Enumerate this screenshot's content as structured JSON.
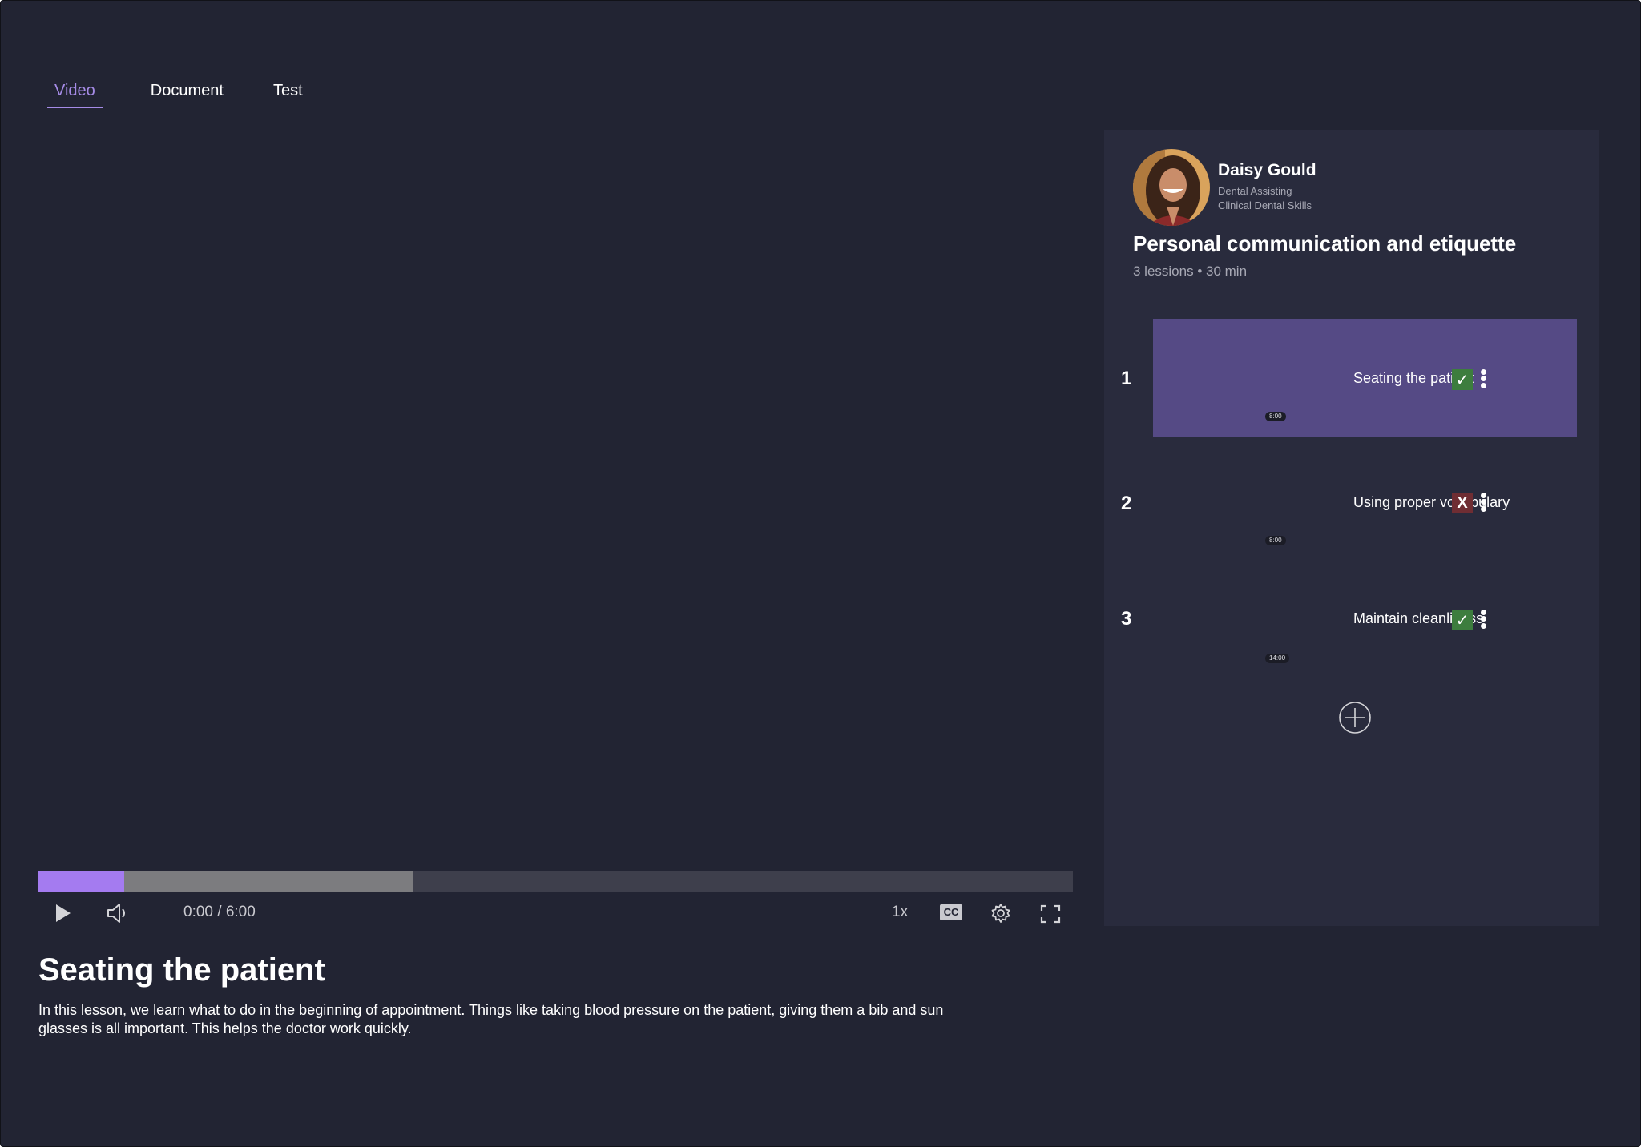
{
  "tabs": [
    {
      "label": "Video",
      "active": true
    },
    {
      "label": "Document",
      "active": false
    },
    {
      "label": "Test",
      "active": false
    }
  ],
  "player": {
    "time": "0:00 / 6:00",
    "played_fraction": 0.083,
    "buffered_fraction": 0.362,
    "speed": "1x",
    "cc_label": "CC",
    "play_icon": "play-icon",
    "volume_icon": "volume-icon",
    "settings_icon": "gear-icon",
    "fullscreen_icon": "fullscreen-icon"
  },
  "lesson": {
    "title": "Seating the patient",
    "description": "In this lesson, we learn what to do in the beginning of appointment.  Things like taking blood pressure on the patient, giving them a bib and sun glasses is all important.  This helps the doctor work quickly."
  },
  "author": {
    "name": "Daisy Gould",
    "line1": "Dental Assisting",
    "line2": "Clinical Dental Skills"
  },
  "course": {
    "title": "Personal communication and etiquette",
    "meta": "3 lessions • 30 min"
  },
  "lessons": [
    {
      "number": "1",
      "name": "Seating the patient",
      "duration": "8:00",
      "status": "pass",
      "status_glyph": "✓",
      "selected": true
    },
    {
      "number": "2",
      "name": "Using proper vocabulary",
      "duration": "8:00",
      "status": "fail",
      "status_glyph": "X",
      "selected": false
    },
    {
      "number": "3",
      "name": "Maintain cleanliness",
      "duration": "14:00",
      "status": "pass",
      "status_glyph": "✓",
      "selected": false
    }
  ],
  "colors": {
    "background": "#222433",
    "panel": "#292b3d",
    "accent": "#a47bf0",
    "selected_card": "#554a85",
    "pass": "#3d7d3e",
    "fail": "#6f2d33"
  }
}
